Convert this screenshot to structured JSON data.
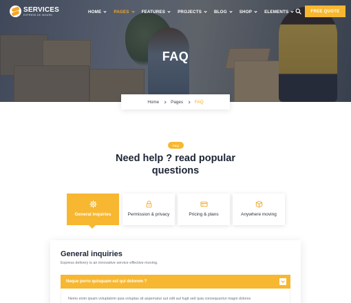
{
  "brand": {
    "name": "SERVICES",
    "tagline": "EXPRESS DE INOURS"
  },
  "nav": {
    "items": [
      {
        "label": "HOME",
        "active": false
      },
      {
        "label": "PAGES",
        "active": true
      },
      {
        "label": "FEATURES",
        "active": false
      },
      {
        "label": "PROJECTS",
        "active": false
      },
      {
        "label": "BLOG",
        "active": false
      },
      {
        "label": "SHOP",
        "active": false
      },
      {
        "label": "ELEMENTS",
        "active": false
      }
    ],
    "quote_button": "FREE QUOTE"
  },
  "hero": {
    "title": "FAQ"
  },
  "breadcrumb": {
    "items": [
      "Home",
      "Pages"
    ],
    "current": "FAQ"
  },
  "section": {
    "tag": "FAQ",
    "title_line1": "Need help ? read popular",
    "title_line2": "questions"
  },
  "categories": [
    {
      "label": "General inquiries",
      "icon": "gear-icon",
      "active": true
    },
    {
      "label": "Permission & privacy",
      "icon": "lock-icon",
      "active": false
    },
    {
      "label": "Pricing & plans",
      "icon": "credit-card-icon",
      "active": false
    },
    {
      "label": "Anywhere moving",
      "icon": "box-icon",
      "active": false
    }
  ],
  "faq": {
    "title": "General inquiries",
    "description": "Express delivery is an innovative service effective moving.",
    "question": "Neque porro quisquam est qui dolorem ?",
    "answer": "Nemo enim ipsam voluptatem quia voluptas sit aspernatur aut odit aut fugit sed quia consequuntur magni dolores"
  },
  "colors": {
    "accent": "#f7b731",
    "heading": "#1c2434",
    "muted": "#6b7280"
  }
}
